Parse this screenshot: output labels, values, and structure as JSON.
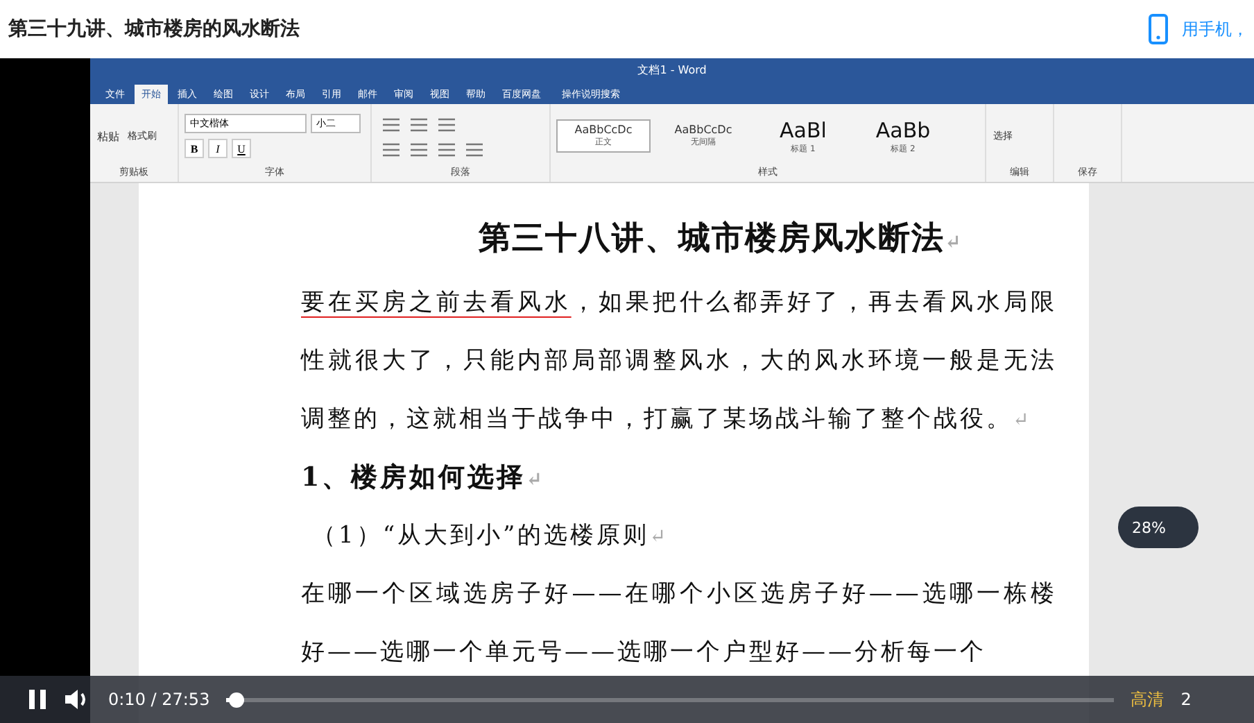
{
  "header": {
    "title": "第三十九讲、城市楼房的风水断法",
    "phone_link": "用手机，"
  },
  "word": {
    "title": "文档1 - Word",
    "tabs": [
      {
        "label": "文件",
        "selected": false
      },
      {
        "label": "开始",
        "selected": true
      },
      {
        "label": "插入",
        "selected": false
      },
      {
        "label": "绘图",
        "selected": false
      },
      {
        "label": "设计",
        "selected": false
      },
      {
        "label": "布局",
        "selected": false
      },
      {
        "label": "引用",
        "selected": false
      },
      {
        "label": "邮件",
        "selected": false
      },
      {
        "label": "审阅",
        "selected": false
      },
      {
        "label": "视图",
        "selected": false
      },
      {
        "label": "帮助",
        "selected": false
      },
      {
        "label": "百度网盘",
        "selected": false
      }
    ],
    "search": "操作说明搜索",
    "ribbon": [
      {
        "kind": "clipboard",
        "label": "剪贴板",
        "paste": "粘贴",
        "painter": "格式刷"
      },
      {
        "kind": "font",
        "label": "字体",
        "font_name": "中文楷体",
        "font_size": "小二",
        "buttons": [
          "B",
          "I",
          "U"
        ]
      },
      {
        "kind": "paragraph",
        "label": "段落"
      },
      {
        "kind": "styles",
        "label": "样式",
        "styles": [
          {
            "sample": "AaBbCcDc",
            "name": "正文",
            "selected": true
          },
          {
            "sample": "AaBbCcDc",
            "name": "无间隔",
            "selected": false
          },
          {
            "sample": "AaBl",
            "name": "标题 1",
            "selected": false
          },
          {
            "sample": "AaBb",
            "name": "标题 2",
            "selected": false
          }
        ]
      },
      {
        "kind": "editing",
        "label": "编辑",
        "action": "选择"
      },
      {
        "kind": "save",
        "label": "保存"
      }
    ],
    "document": {
      "mark": "↵",
      "blocks": [
        {
          "kind": "title",
          "text": "第三十八讲、城市楼房风水断法"
        },
        {
          "kind": "body",
          "marked": "要在买房之前去看风水",
          "text": "，如果把什么都弄好了，再去看风水局限性就很大了，只能内部局部调整风水，大的风水环境一般是无法调整的，这就相当于战争中，打赢了某场战斗输了整个战役。"
        },
        {
          "kind": "heading",
          "text": "1、楼房如何选择"
        },
        {
          "kind": "sub",
          "text": "（1）“从大到小”的选楼原则"
        },
        {
          "kind": "body",
          "text": "在哪一个区域选房子好——在哪个小区选房子好——选哪一栋楼好——选哪一个单元号——选哪一个户型好——分析每一个"
        }
      ]
    }
  },
  "meter": {
    "reading": "28%"
  },
  "player": {
    "playing": true,
    "time": "0:10 / 27:53",
    "level": 0.006,
    "quality": "高清",
    "more": "2"
  }
}
